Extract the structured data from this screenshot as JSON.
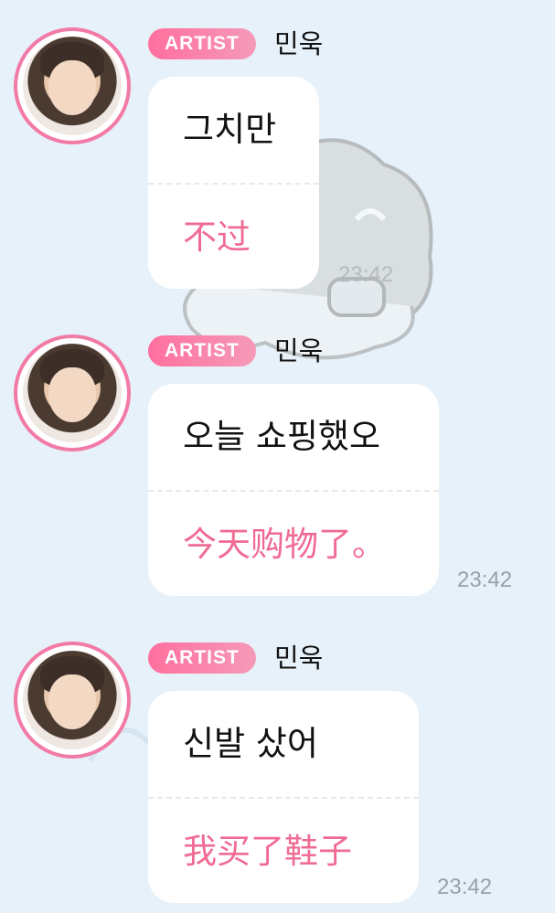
{
  "messages": [
    {
      "badge": "ARTIST",
      "sender": "민욱",
      "korean": "그치만",
      "chinese": "不过",
      "time": "23:42"
    },
    {
      "badge": "ARTIST",
      "sender": "민욱",
      "korean": "오늘 쇼핑했오",
      "chinese": "今天购物了。",
      "time": "23:42"
    },
    {
      "badge": "ARTIST",
      "sender": "민욱",
      "korean": "신발 샀어",
      "chinese": "我买了鞋子",
      "time": "23:42"
    }
  ],
  "colors": {
    "background": "#e6f1f9",
    "accent": "#f06b94",
    "badge": "#ff6f9e",
    "bubble": "#ffffff"
  },
  "icons": {
    "background_sticker": "cat-sticker-icon"
  }
}
